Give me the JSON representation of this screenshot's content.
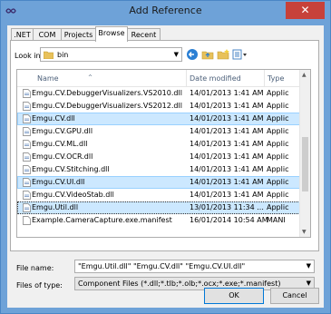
{
  "window": {
    "title": "Add Reference",
    "close_glyph": "✕"
  },
  "tabs": [
    {
      "label": ".NET"
    },
    {
      "label": "COM"
    },
    {
      "label": "Projects"
    },
    {
      "label": "Browse"
    },
    {
      "label": "Recent"
    }
  ],
  "active_tab": "Browse",
  "look_in": {
    "label": "Look in:",
    "value": "bin"
  },
  "columns": {
    "name": "Name",
    "date": "Date modified",
    "type": "Type"
  },
  "files": [
    {
      "name": "Emgu.CV.DebuggerVisualizers.VS2010.dll",
      "date": "14/01/2013 1:41 AM",
      "type": "Applic",
      "selected": false
    },
    {
      "name": "Emgu.CV.DebuggerVisualizers.VS2012.dll",
      "date": "14/01/2013 1:41 AM",
      "type": "Applic",
      "selected": false
    },
    {
      "name": "Emgu.CV.dll",
      "date": "14/01/2013 1:41 AM",
      "type": "Applic",
      "selected": true
    },
    {
      "name": "Emgu.CV.GPU.dll",
      "date": "14/01/2013 1:41 AM",
      "type": "Applic",
      "selected": false
    },
    {
      "name": "Emgu.CV.ML.dll",
      "date": "14/01/2013 1:41 AM",
      "type": "Applic",
      "selected": false
    },
    {
      "name": "Emgu.CV.OCR.dll",
      "date": "14/01/2013 1:41 AM",
      "type": "Applic",
      "selected": false
    },
    {
      "name": "Emgu.CV.Stitching.dll",
      "date": "14/01/2013 1:41 AM",
      "type": "Applic",
      "selected": false
    },
    {
      "name": "Emgu.CV.UI.dll",
      "date": "14/01/2013 1:41 AM",
      "type": "Applic",
      "selected": true
    },
    {
      "name": "Emgu.CV.VideoStab.dll",
      "date": "14/01/2013 1:41 AM",
      "type": "Applic",
      "selected": false
    },
    {
      "name": "Emgu.Util.dll",
      "date": "13/01/2013 11:34 ...",
      "type": "Applic",
      "selected": true,
      "focused": true
    },
    {
      "name": "Example.CameraCapture.exe.manifest",
      "date": "16/01/2014 10:54 AM",
      "type": "MANI",
      "selected": false
    }
  ],
  "file_name": {
    "label": "File name:",
    "value": "\"Emgu.Util.dll\" \"Emgu.CV.dll\" \"Emgu.CV.UI.dll\""
  },
  "files_of_type": {
    "label": "Files of type:",
    "value": "Component Files (*.dll;*.tlb;*.olb;*.ocx;*.exe;*.manifest)"
  },
  "buttons": {
    "ok": "OK",
    "cancel": "Cancel"
  },
  "colors": {
    "accent": "#0078d7",
    "selection": "#cce8ff",
    "close": "#c7413a"
  }
}
